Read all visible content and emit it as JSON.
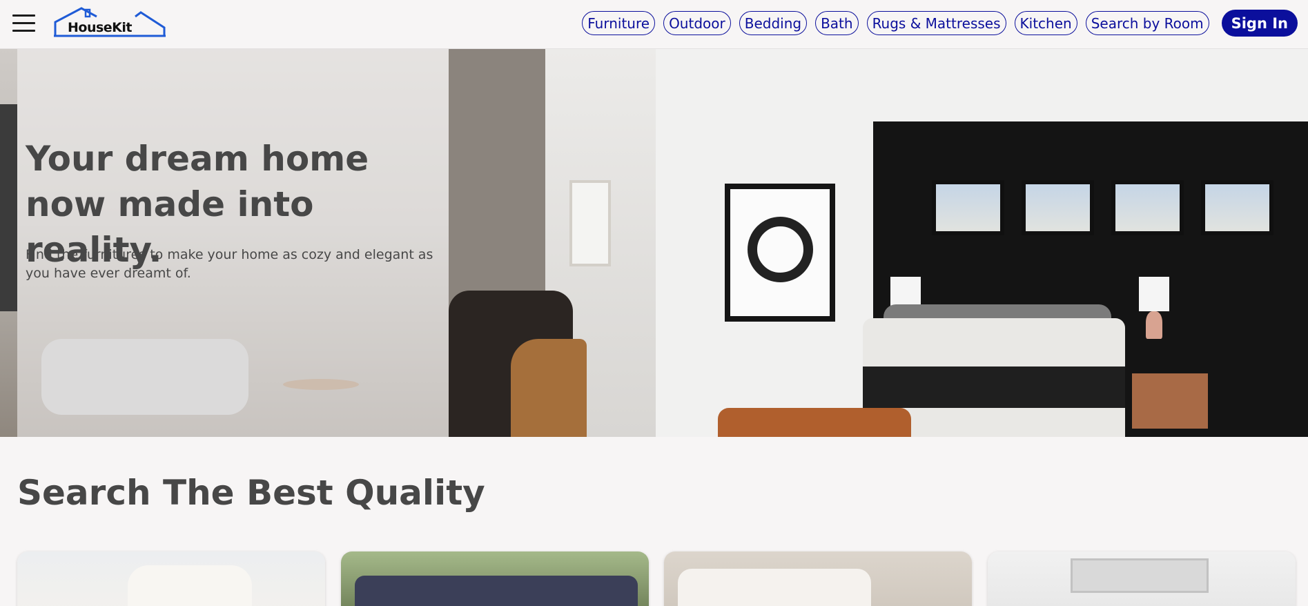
{
  "header": {
    "logo_text": "HouseKit",
    "nav_items": [
      {
        "label": "Furniture"
      },
      {
        "label": "Outdoor"
      },
      {
        "label": "Bedding"
      },
      {
        "label": "Bath"
      },
      {
        "label": "Rugs & Mattresses"
      },
      {
        "label": "Kitchen"
      },
      {
        "label": "Search by Room"
      }
    ],
    "signin_label": "Sign In",
    "accent_color": "#0b0f9c"
  },
  "hero": {
    "title": "Your dream home now made into reality.",
    "subtitle": "Find the furnitures to make your home as cozy and elegant as you have ever dreamt of.",
    "images": [
      "living-room-photo",
      "bedroom-photo"
    ]
  },
  "section": {
    "title": "Search The Best Quality",
    "cards": [
      "sofa-photo",
      "outdoor-furniture-photo",
      "bedding-photo",
      "bath-photo"
    ]
  },
  "icons": {
    "menu": "hamburger-menu-icon",
    "logo": "house-logo-icon"
  }
}
